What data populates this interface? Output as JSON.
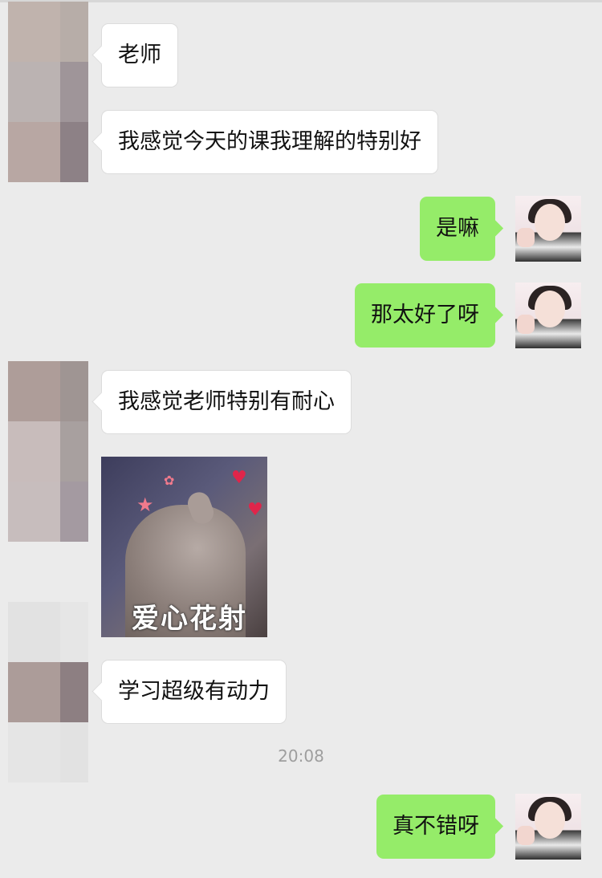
{
  "messages": {
    "m1": "老师",
    "m2": "我感觉今天的课我理解的特别好",
    "m3": "是嘛",
    "m4": "那太好了呀",
    "m5": "我感觉老师特别有耐心",
    "sticker_caption": "爱心花射",
    "m6": "学习超级有动力",
    "m7": "真不错呀"
  },
  "timestamp": "20:08",
  "colors": {
    "background": "#ebebeb",
    "incoming_bubble": "#ffffff",
    "outgoing_bubble": "#95ec69",
    "timestamp_text": "#9e9e9e"
  },
  "icons": {
    "sent_avatar": "user-photo-avatar",
    "received_avatar": "blurred-avatar"
  }
}
